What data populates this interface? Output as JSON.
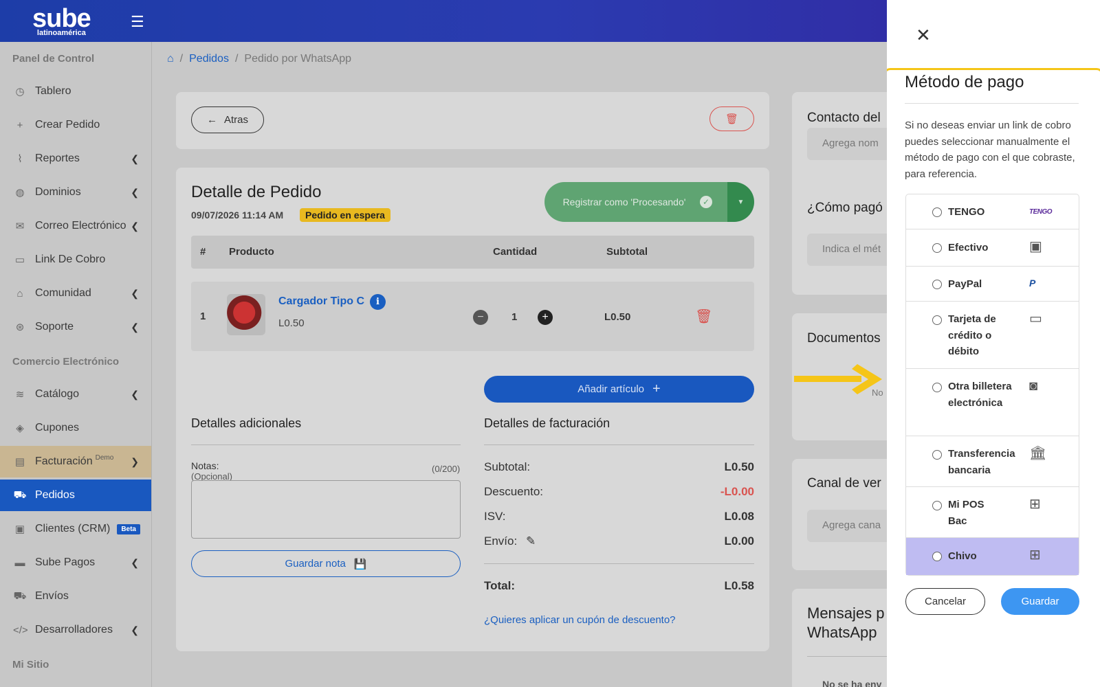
{
  "logo": {
    "line1": "sube",
    "line2": "latinoamérica"
  },
  "sidebar": {
    "sections": [
      "Panel de Control",
      "Comercio Electrónico",
      "Mi Sitio"
    ],
    "items": [
      {
        "label": "Tablero",
        "icon": "clock-icon"
      },
      {
        "label": "Crear Pedido",
        "icon": "plus-icon"
      },
      {
        "label": "Reportes",
        "icon": "chart-icon"
      },
      {
        "label": "Dominios",
        "icon": "globe-icon"
      },
      {
        "label": "Correo Electrónico",
        "icon": "mail-icon"
      },
      {
        "label": "Link De Cobro",
        "icon": "folder-icon"
      },
      {
        "label": "Comunidad",
        "icon": "community-icon"
      },
      {
        "label": "Soporte",
        "icon": "support-icon"
      },
      {
        "label": "Catálogo",
        "icon": "layers-icon"
      },
      {
        "label": "Cupones",
        "icon": "tag-icon"
      },
      {
        "label": "Facturación",
        "icon": "invoice-icon",
        "badge": "Demo"
      },
      {
        "label": "Pedidos",
        "icon": "cart-icon"
      },
      {
        "label": "Clientes (CRM)",
        "icon": "contacts-icon",
        "badge": "Beta"
      },
      {
        "label": "Sube Pagos",
        "icon": "card-icon"
      },
      {
        "label": "Envíos",
        "icon": "truck-icon"
      },
      {
        "label": "Desarrolladores",
        "icon": "code-icon"
      }
    ]
  },
  "breadcrumb": {
    "link": "Pedidos",
    "current": "Pedido por WhatsApp"
  },
  "toolbar": {
    "back_label": "Atras"
  },
  "order": {
    "title": "Detalle de Pedido",
    "date": "09/07/2026 11:14 AM",
    "status": "Pedido en espera",
    "register_label": "Registrar como 'Procesando'",
    "columns": [
      "#",
      "Producto",
      "Cantidad",
      "Subtotal"
    ],
    "items": [
      {
        "num": "1",
        "name": "Cargador Tipo C",
        "price": "L0.50",
        "qty": "1",
        "subtotal": "L0.50"
      }
    ],
    "add_label": "Añadir artículo"
  },
  "extra": {
    "title": "Detalles adicionales",
    "notes_label": "Notas:",
    "notes_optional": "(Opcional)",
    "notes_count": "(0/200)",
    "save_note_label": "Guardar nota"
  },
  "billing": {
    "title": "Detalles de facturación",
    "rows": [
      {
        "label": "Subtotal:",
        "value": "L0.50"
      },
      {
        "label": "Descuento:",
        "value": "-L0.00"
      },
      {
        "label": "ISV:",
        "value": "L0.08"
      },
      {
        "label": "Envío:",
        "value": "L0.00"
      }
    ],
    "total_label": "Total:",
    "total_value": "L0.58",
    "coupon_label": "¿Quieres aplicar un cupón de descuento?"
  },
  "right_cards": {
    "contact_title": "Contacto del",
    "contact_placeholder": "Agrega nom",
    "pay_title": "¿Cómo pagó",
    "pay_placeholder": "Indica el mét",
    "docs_title": "Documentos",
    "docs_text": "No",
    "channel_title": "Canal de ver",
    "channel_placeholder": "Agrega cana",
    "messages_title_1": "Mensajes p",
    "messages_title_2": "WhatsApp",
    "messages_text": "No se ha env"
  },
  "drawer": {
    "title": "Método de pago",
    "description": "Si no deseas enviar un link de cobro puedes seleccionar manualmente el método de pago con el que cobraste, para referencia.",
    "options": [
      {
        "label": "TENGO",
        "icon": "tengo-logo-icon",
        "logo_text": "TENGO"
      },
      {
        "label": "Efectivo",
        "icon": "cash-icon"
      },
      {
        "label": "PayPal",
        "icon": "paypal-icon",
        "logo_text": "P"
      },
      {
        "label": "Tarjeta de crédito o débito",
        "icon": "credit-card-icon"
      },
      {
        "label": "Otra billetera electrónica",
        "icon": "wallet-icon"
      },
      {
        "label": "Transferencia bancaria",
        "icon": "bank-icon"
      },
      {
        "label": "Mi POS Bac",
        "icon": "grid-plus-icon"
      },
      {
        "label": "Chivo",
        "icon": "grid-plus-icon",
        "selected": true
      }
    ],
    "cancel_label": "Cancelar",
    "save_label": "Guardar"
  },
  "colors": {
    "brand": "#1958bf",
    "highlight": "#f5c518",
    "selected_option": "#bfbcf2",
    "danger": "#d9534f",
    "success": "#5fa472"
  }
}
